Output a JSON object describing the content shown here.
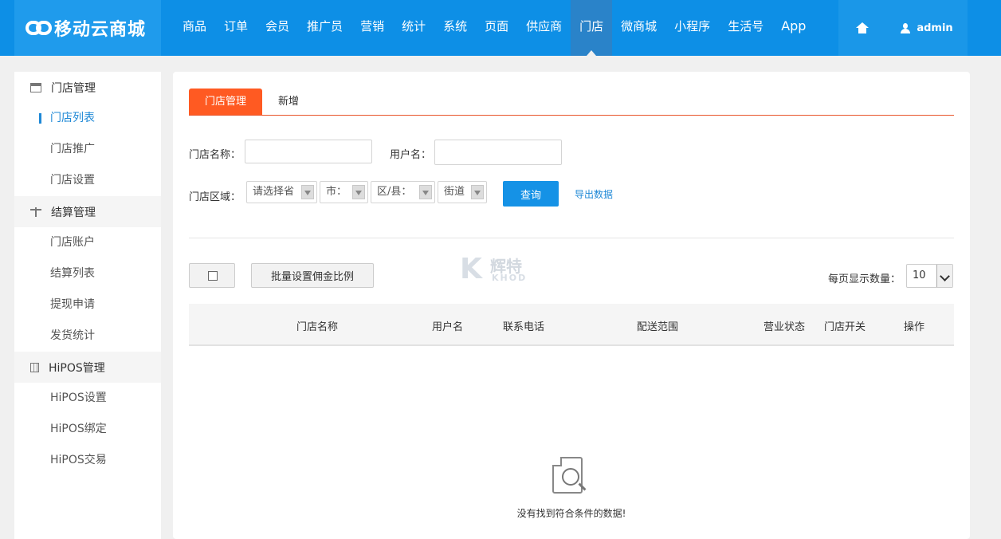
{
  "header": {
    "logo_text": "移动云商城",
    "nav": [
      "商品",
      "订单",
      "会员",
      "推广员",
      "营销",
      "统计",
      "系统",
      "页面",
      "供应商",
      "门店",
      "微商城",
      "小程序",
      "生活号",
      "App"
    ],
    "active_nav": "门店",
    "user": "admin",
    "brand_color": "#0d8fe6"
  },
  "sidebar": {
    "groups": [
      {
        "label": "门店管理",
        "icon": "store-icon",
        "items": [
          "门店列表",
          "门店推广",
          "门店设置"
        ]
      },
      {
        "label": "结算管理",
        "icon": "scale-icon",
        "items": [
          "门店账户",
          "结算列表",
          "提现申请",
          "发货统计"
        ]
      },
      {
        "label": "HiPOS管理",
        "icon": "calculator-icon",
        "items": [
          "HiPOS设置",
          "HiPOS绑定",
          "HiPOS交易"
        ]
      }
    ],
    "active_item": "门店列表"
  },
  "tabs": [
    "门店管理",
    "新增"
  ],
  "filters": {
    "store_name_label": "门店名称：",
    "store_name_value": "",
    "username_label": "用户名：",
    "username_value": "",
    "region_label": "门店区域：",
    "province": "请选择省",
    "city": "市：",
    "district": "区/县：",
    "street": "街道",
    "query_button": "查询",
    "export_link": "导出数据"
  },
  "toolbar": {
    "batch_button": "批量设置佣金比例",
    "per_page_label": "每页显示数量：",
    "per_page_value": "10"
  },
  "watermark": {
    "letter": "K",
    "cn": "辉特",
    "en": "KHOD"
  },
  "table": {
    "columns": [
      "门店名称",
      "用户名",
      "联系电话",
      "配送范围",
      "营业状态",
      "门店开关",
      "操作"
    ],
    "rows": []
  },
  "empty_message": "没有找到符合条件的数据!",
  "colors": {
    "accent_orange": "#ff5a22",
    "button_blue": "#1592e6",
    "link_blue": "#1e88d6"
  }
}
